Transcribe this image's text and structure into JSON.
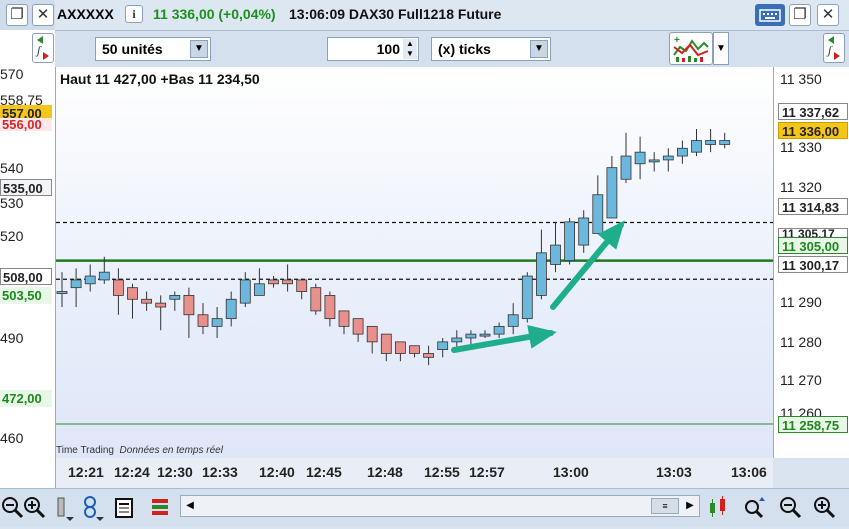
{
  "titlebar": {
    "symbol_fragment": "AXXXXX",
    "price_change": "11 336,00 (+0,04%)",
    "time_instrument": "13:06:09 DAX30 Full1218 Future",
    "close_glyph": "✕",
    "restore_glyph": "❐",
    "info_glyph": "i"
  },
  "toolbar": {
    "units_select": "50 unités",
    "ticks_value": "100",
    "ticks_select": "(x) ticks"
  },
  "left_panel": {
    "ticks": [
      "570",
      "558,75",
      "540",
      "530",
      "520",
      "490",
      "460"
    ],
    "box_557": "557,00",
    "box_556": "556,00",
    "box_535": "535,00",
    "box_508": "508,00",
    "box_503": "503,50",
    "box_472": "472,00"
  },
  "chart": {
    "high_low": "Haut 11 427,00 +Bas 11 234,50",
    "footer_left": "Time Trading",
    "footer_right": "Données en temps réel"
  },
  "y_axis": {
    "labels": [
      "11 350",
      "11 330",
      "11 320",
      "11 290",
      "11 280",
      "11 270"
    ],
    "box_33762": "11 337,62",
    "box_336": "11 336,00",
    "box_31483": "11 314,83",
    "box_30517": "11 305,17",
    "box_305": "11 305,00",
    "box_30017": "11 300,17",
    "box_25875": "11 258,75",
    "partial_260": "11 260"
  },
  "x_axis": {
    "labels": [
      "12:21",
      "12:24",
      "12:30",
      "12:33",
      "12:40",
      "12:45",
      "12:48",
      "12:55",
      "12:57",
      "13:00",
      "13:03",
      "13:06"
    ]
  },
  "colors": {
    "up_candle": "#6bb8dc",
    "down_candle": "#e8908c",
    "arrow": "#1fae8c",
    "hline_green": "#1f7a1f"
  },
  "chart_data": {
    "type": "candlestick",
    "ylim": [
      11254,
      11355
    ],
    "lines": [
      {
        "value": 11314.83,
        "style": "dashed"
      },
      {
        "value": 11305.0,
        "style": "solid-green"
      },
      {
        "value": 11300.17,
        "style": "dashed"
      }
    ],
    "candles": [
      {
        "o": 11297,
        "c": 11297,
        "h": 11302,
        "l": 11293
      },
      {
        "o": 11298,
        "c": 11300,
        "h": 11303,
        "l": 11293
      },
      {
        "o": 11299,
        "c": 11301,
        "h": 11304,
        "l": 11297
      },
      {
        "o": 11300,
        "c": 11302,
        "h": 11306,
        "l": 11299
      },
      {
        "o": 11300,
        "c": 11296,
        "h": 11303,
        "l": 11291
      },
      {
        "o": 11298,
        "c": 11295,
        "h": 11299,
        "l": 11290
      },
      {
        "o": 11295,
        "c": 11294,
        "h": 11297,
        "l": 11292
      },
      {
        "o": 11294,
        "c": 11293,
        "h": 11296,
        "l": 11287
      },
      {
        "o": 11295,
        "c": 11296,
        "h": 11297,
        "l": 11292
      },
      {
        "o": 11296,
        "c": 11291,
        "h": 11298,
        "l": 11285
      },
      {
        "o": 11291,
        "c": 11288,
        "h": 11294,
        "l": 11286
      },
      {
        "o": 11288,
        "c": 11290,
        "h": 11293,
        "l": 11285
      },
      {
        "o": 11290,
        "c": 11295,
        "h": 11297,
        "l": 11288
      },
      {
        "o": 11294,
        "c": 11300,
        "h": 11302,
        "l": 11293
      },
      {
        "o": 11296,
        "c": 11299,
        "h": 11303,
        "l": 11296
      },
      {
        "o": 11300,
        "c": 11299,
        "h": 11301,
        "l": 11298
      },
      {
        "o": 11300,
        "c": 11299,
        "h": 11304,
        "l": 11297
      },
      {
        "o": 11300,
        "c": 11297,
        "h": 11300,
        "l": 11295
      },
      {
        "o": 11298,
        "c": 11292,
        "h": 11299,
        "l": 11291
      },
      {
        "o": 11296,
        "c": 11290,
        "h": 11297,
        "l": 11288
      },
      {
        "o": 11292,
        "c": 11288,
        "h": 11292,
        "l": 11286
      },
      {
        "o": 11290,
        "c": 11286,
        "h": 11290,
        "l": 11284
      },
      {
        "o": 11288,
        "c": 11284,
        "h": 11288,
        "l": 11281
      },
      {
        "o": 11286,
        "c": 11281,
        "h": 11286,
        "l": 11279
      },
      {
        "o": 11284,
        "c": 11281,
        "h": 11284,
        "l": 11279
      },
      {
        "o": 11283,
        "c": 11281,
        "h": 11283,
        "l": 11280
      },
      {
        "o": 11281,
        "c": 11280,
        "h": 11283,
        "l": 11278
      },
      {
        "o": 11282,
        "c": 11284,
        "h": 11285,
        "l": 11280
      },
      {
        "o": 11284,
        "c": 11285,
        "h": 11287,
        "l": 11282
      },
      {
        "o": 11285,
        "c": 11286,
        "h": 11287,
        "l": 11283
      },
      {
        "o": 11286,
        "c": 11286,
        "h": 11287,
        "l": 11285
      },
      {
        "o": 11286,
        "c": 11288,
        "h": 11289,
        "l": 11285
      },
      {
        "o": 11288,
        "c": 11291,
        "h": 11294,
        "l": 11286
      },
      {
        "o": 11290,
        "c": 11301,
        "h": 11302,
        "l": 11289
      },
      {
        "o": 11296,
        "c": 11307,
        "h": 11313,
        "l": 11295
      },
      {
        "o": 11304,
        "c": 11309,
        "h": 11315,
        "l": 11302
      },
      {
        "o": 11305,
        "c": 11315,
        "h": 11316,
        "l": 11304
      },
      {
        "o": 11309,
        "c": 11316,
        "h": 11318,
        "l": 11307
      },
      {
        "o": 11312,
        "c": 11322,
        "h": 11327,
        "l": 11312
      },
      {
        "o": 11316,
        "c": 11329,
        "h": 11332,
        "l": 11316
      },
      {
        "o": 11326,
        "c": 11332,
        "h": 11338,
        "l": 11325
      },
      {
        "o": 11330,
        "c": 11333,
        "h": 11337,
        "l": 11326
      },
      {
        "o": 11331,
        "c": 11331,
        "h": 11333,
        "l": 11328
      },
      {
        "o": 11331,
        "c": 11332,
        "h": 11334,
        "l": 11328
      },
      {
        "o": 11332,
        "c": 11334,
        "h": 11336,
        "l": 11330
      },
      {
        "o": 11333,
        "c": 11336,
        "h": 11339,
        "l": 11332
      },
      {
        "o": 11335,
        "c": 11336,
        "h": 11339,
        "l": 11333
      },
      {
        "o": 11335,
        "c": 11336,
        "h": 11338,
        "l": 11334
      }
    ]
  }
}
